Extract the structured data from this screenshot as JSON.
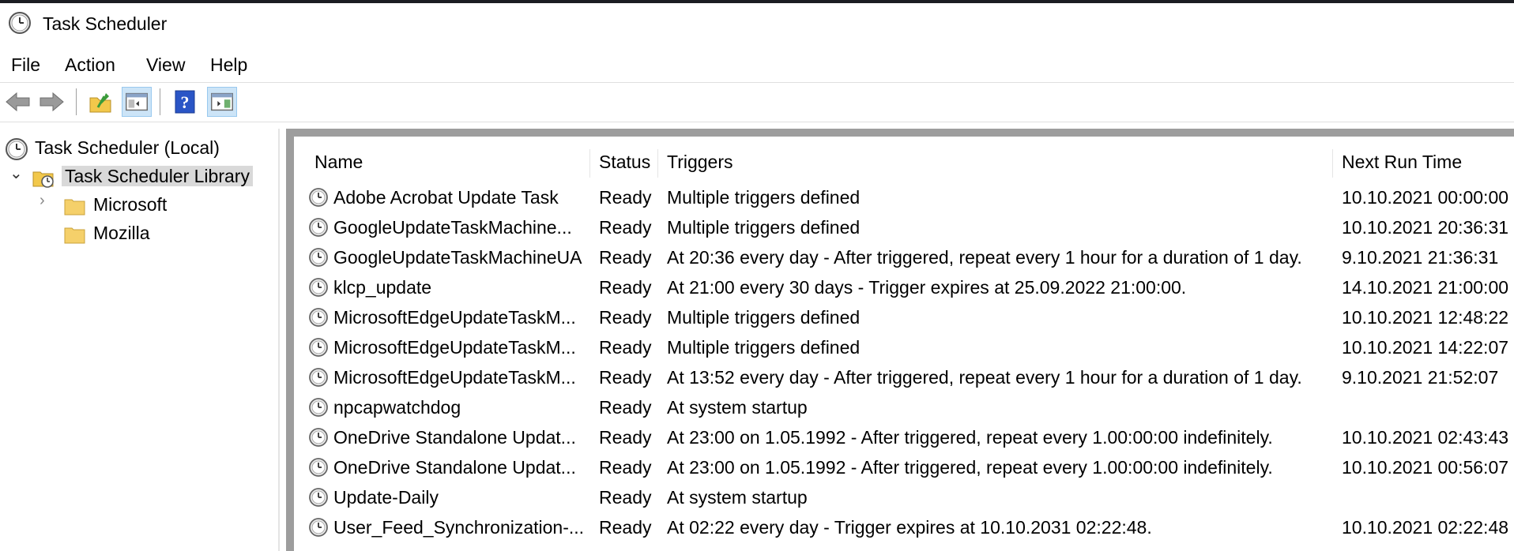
{
  "window": {
    "title": "Task Scheduler"
  },
  "menu": [
    "File",
    "Action",
    "View",
    "Help"
  ],
  "toolbar": {
    "buttons": [
      "back-icon",
      "forward-icon",
      "up-folder-icon",
      "show-hide-console-tree-icon",
      "help-icon",
      "show-hide-action-pane-icon"
    ]
  },
  "tree": {
    "root": "Task Scheduler (Local)",
    "library": "Task Scheduler Library",
    "children": [
      "Microsoft",
      "Mozilla"
    ]
  },
  "table": {
    "columns": [
      "Name",
      "Status",
      "Triggers",
      "Next Run Time"
    ],
    "rows": [
      [
        "Adobe Acrobat Update Task",
        "Ready",
        "Multiple triggers defined",
        "10.10.2021 00:00:00"
      ],
      [
        "GoogleUpdateTaskMachine...",
        "Ready",
        "Multiple triggers defined",
        "10.10.2021 20:36:31"
      ],
      [
        "GoogleUpdateTaskMachineUA",
        "Ready",
        "At 20:36 every day - After triggered, repeat every 1 hour for a duration of 1 day.",
        "9.10.2021 21:36:31"
      ],
      [
        "klcp_update",
        "Ready",
        "At 21:00 every 30 days - Trigger expires at 25.09.2022 21:00:00.",
        "14.10.2021 21:00:00"
      ],
      [
        "MicrosoftEdgeUpdateTaskM...",
        "Ready",
        "Multiple triggers defined",
        "10.10.2021 12:48:22"
      ],
      [
        "MicrosoftEdgeUpdateTaskM...",
        "Ready",
        "Multiple triggers defined",
        "10.10.2021 14:22:07"
      ],
      [
        "MicrosoftEdgeUpdateTaskM...",
        "Ready",
        "At 13:52 every day - After triggered, repeat every 1 hour for a duration of 1 day.",
        "9.10.2021 21:52:07"
      ],
      [
        "npcapwatchdog",
        "Ready",
        "At system startup",
        ""
      ],
      [
        "OneDrive Standalone Updat...",
        "Ready",
        "At 23:00 on 1.05.1992 - After triggered, repeat every 1.00:00:00 indefinitely.",
        "10.10.2021 02:43:43"
      ],
      [
        "OneDrive Standalone Updat...",
        "Ready",
        "At 23:00 on 1.05.1992 - After triggered, repeat every 1.00:00:00 indefinitely.",
        "10.10.2021 00:56:07"
      ],
      [
        "Update-Daily",
        "Ready",
        "At system startup",
        ""
      ],
      [
        "User_Feed_Synchronization-...",
        "Ready",
        "At 02:22 every day - Trigger expires at 10.10.2031 02:22:48.",
        "10.10.2021 02:22:48"
      ]
    ]
  },
  "colors": {
    "selection": "#d9d9d9",
    "pane_frame": "#9d9d9d",
    "toolbar_pressed": "#cce4f7"
  }
}
